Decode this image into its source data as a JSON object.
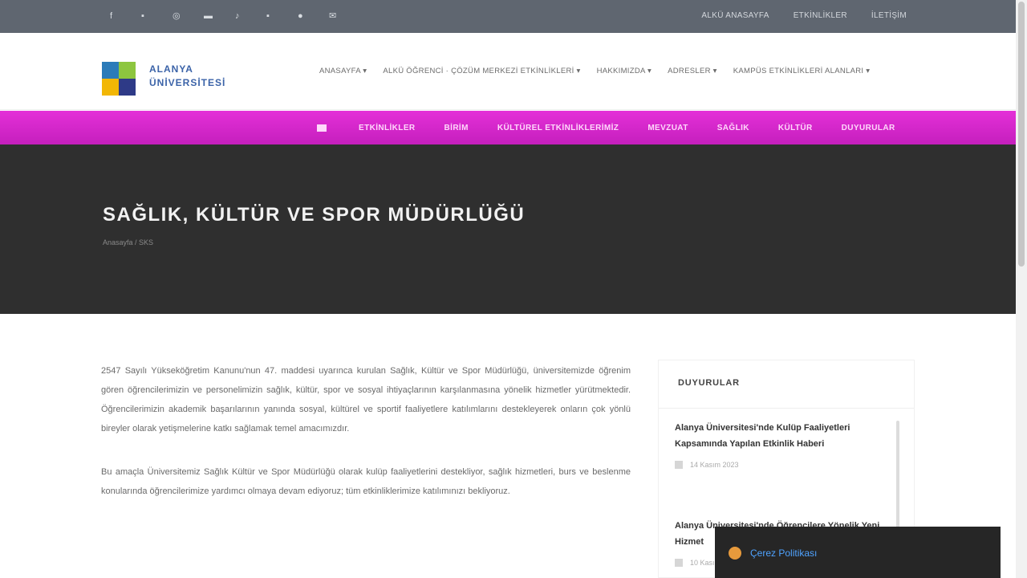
{
  "topbar": {
    "social_icons": [
      "facebook-icon",
      "twitter-icon",
      "instagram-icon",
      "youtube-icon",
      "tiktok-icon",
      "linkedin-icon",
      "pinterest-icon",
      "email-icon"
    ],
    "social_glyphs": [
      "f",
      "▪",
      "◎",
      "▬",
      "♪",
      "▪",
      "●",
      "✉"
    ],
    "links": [
      "ALKÜ ANASAYFA",
      "ETKİNLİKLER",
      "İLETİŞİM"
    ]
  },
  "header": {
    "logo_line1": "ALANYA",
    "logo_line2": "ÜNİVERSİTESİ",
    "nav": [
      "ANASAYFA ▾",
      "ALKÜ ÖĞRENCİ · ÇÖZÜM MERKEZİ ETKİNLİKLERİ ▾",
      "HAKKIMIZDA ▾",
      "ADRESLER ▾",
      "KAMPÜS ETKİNLİKLERİ ALANLARI ▾"
    ]
  },
  "subnav": {
    "items": [
      "ETKİNLİKLER",
      "BİRİM",
      "KÜLTÜREL ETKİNLİKLERİMİZ",
      "MEVZUAT",
      "SAĞLIK",
      "KÜLTÜR",
      "DUYURULAR"
    ]
  },
  "hero": {
    "title": "SAĞLIK, KÜLTÜR VE SPOR MÜDÜRLÜĞÜ",
    "breadcrumb": "Anasayfa / SKS"
  },
  "content": {
    "paragraphs": [
      "2547 Sayılı Yükseköğretim Kanunu'nun 47. maddesi uyarınca kurulan Sağlık, Kültür ve Spor Müdürlüğü, üniversitemizde öğrenim gören öğrencilerimizin ve personelimizin sağlık, kültür, spor ve sosyal ihtiyaçlarının karşılanmasına yönelik hizmetler yürütmektedir. Öğrencilerimizin akademik başarılarının yanında sosyal, kültürel ve sportif faaliyetlere katılımlarını destekleyerek onların çok yönlü bireyler olarak yetişmelerine katkı sağlamak temel amacımızdır.",
      "Bu amaçla Üniversitemiz Sağlık Kültür ve Spor Müdürlüğü olarak kulüp faaliyetlerini destekliyor, sağlık hizmetleri, burs ve beslenme konularında öğrencilerimize yardımcı olmaya devam ediyoruz; tüm etkinliklerimize katılımınızı bekliyoruz."
    ]
  },
  "sidebar": {
    "heading": "DUYURULAR",
    "news": [
      {
        "title": "Alanya Üniversitesi'nde Kulüp Faaliyetleri Kapsamında Yapılan Etkinlik Haberi",
        "date": "14 Kasım 2023"
      },
      {
        "title": "Alanya Üniversitesi'nde Öğrencilere Yönelik Yeni Hizmet",
        "date": "10 Kasım 2023"
      }
    ]
  },
  "cookie": {
    "label": "Çerez Politikası"
  }
}
